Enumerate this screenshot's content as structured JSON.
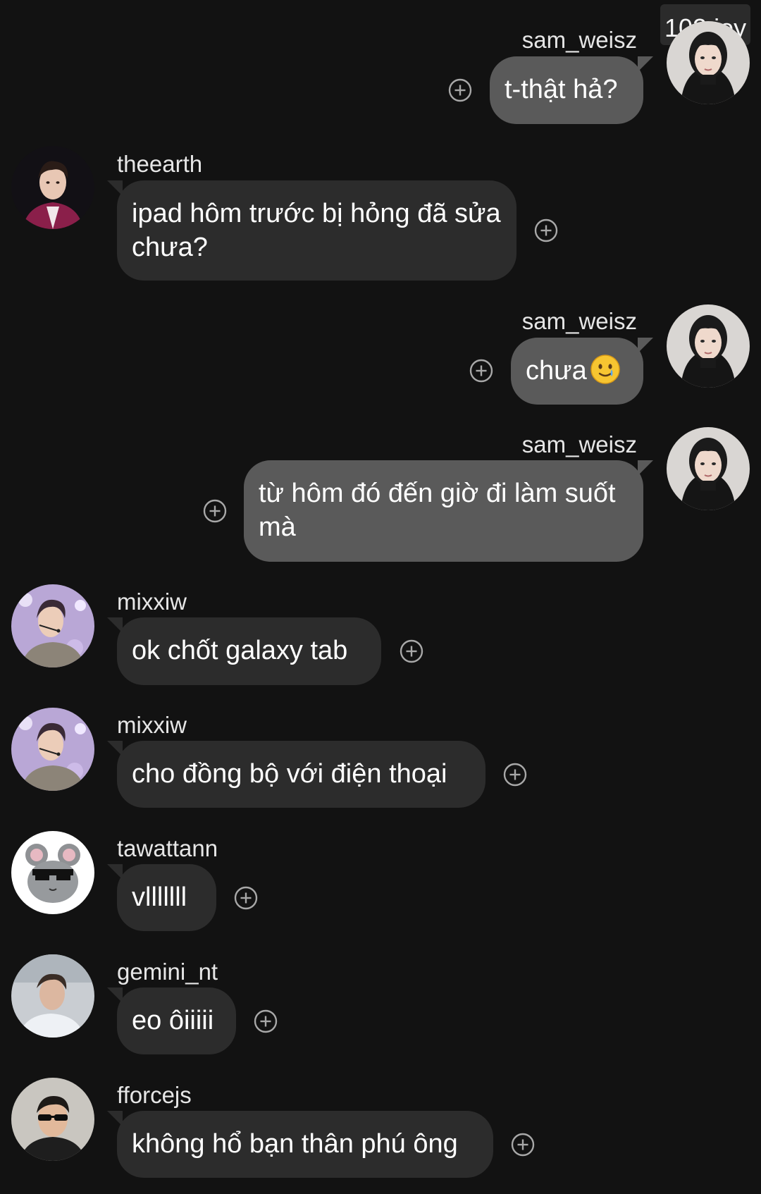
{
  "counter_badge": "102 joy",
  "messages": [
    {
      "sender": "sam_weisz",
      "text": "t-thật hả?"
    },
    {
      "sender": "theearth",
      "text": "ipad hôm trước bị hỏng đã sửa chưa?"
    },
    {
      "sender": "sam_weisz",
      "text": "chưa"
    },
    {
      "sender": "sam_weisz",
      "text": "từ hôm đó đến giờ đi làm suốt mà"
    },
    {
      "sender": "mixxiw",
      "text": "ok chốt galaxy tab"
    },
    {
      "sender": "mixxiw",
      "text": "cho đồng bộ với điện thoại"
    },
    {
      "sender": "tawattann",
      "text": "vlllllll"
    },
    {
      "sender": "gemini_nt",
      "text": "eo ôiiiii"
    },
    {
      "sender": "fforcejs",
      "text": "không hổ bạn thân phú ông"
    }
  ],
  "icons": {
    "react_button": "plus-circle-icon",
    "emoji_msg3": "smiling-face-with-tear-emoji"
  },
  "colors": {
    "background": "#121212",
    "outgoing_bubble": "#5a5a5a",
    "incoming_bubble": "#2c2c2c"
  }
}
